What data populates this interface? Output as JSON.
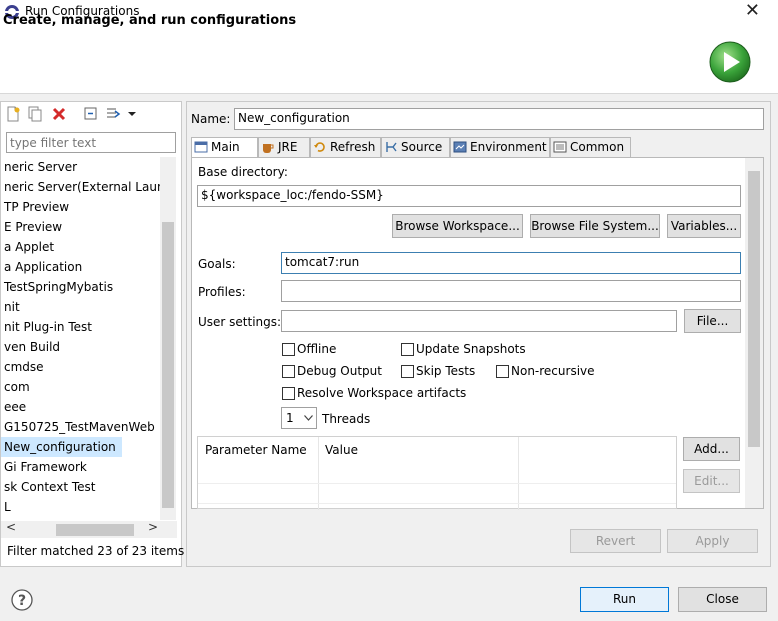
{
  "window": {
    "title": "Run Configurations",
    "close_glyph": "✕"
  },
  "banner": {
    "title": "Create, manage, and run configurations",
    "icon": "run-icon"
  },
  "left": {
    "toolbar_icons": [
      "new-launch-config-icon",
      "duplicate-icon",
      "delete-icon",
      "collapse-all-icon",
      "filter-icon",
      "chevron-down-icon"
    ],
    "filter_placeholder": "type filter text",
    "tree_items": [
      "neric Server",
      "neric Server(External Launc",
      "TP Preview",
      "E Preview",
      "a Applet",
      "a Application",
      "TestSpringMybatis",
      "nit",
      "nit Plug-in Test",
      "ven Build",
      "cmdse",
      "com",
      "eee",
      "G150725_TestMavenWeb",
      "New_configuration",
      "Gi Framework",
      "sk Context Test",
      "L"
    ],
    "selected_item": "New_configuration",
    "hscroll_left": "<",
    "hscroll_right": ">",
    "filter_status": "Filter matched 23 of 23 items"
  },
  "right": {
    "name_label": "Name:",
    "name_value": "New_configuration",
    "tabs": [
      {
        "label": "Main",
        "icon": "main-tab-icon"
      },
      {
        "label": "JRE",
        "icon": "jre-icon"
      },
      {
        "label": "Refresh",
        "icon": "refresh-icon"
      },
      {
        "label": "Source",
        "icon": "source-icon"
      },
      {
        "label": "Environment",
        "icon": "environment-icon"
      },
      {
        "label": "Common",
        "icon": "common-icon"
      }
    ],
    "base_dir_label": "Base directory:",
    "base_dir_value": "${workspace_loc:/fendo-SSM}",
    "browse_workspace": "Browse Workspace...",
    "browse_fs": "Browse File System...",
    "variables": "Variables...",
    "goals_label": "Goals:",
    "goals_value": "tomcat7:run",
    "profiles_label": "Profiles:",
    "profiles_value": "",
    "user_settings_label": "User settings:",
    "user_settings_value": "",
    "file_button": "File...",
    "offline": "Offline",
    "update_snapshots": "Update Snapshots",
    "debug_output": "Debug Output",
    "skip_tests": "Skip Tests",
    "non_recursive": "Non-recursive",
    "resolve_ws": "Resolve Workspace artifacts",
    "threads_value": "1",
    "threads_label": "Threads",
    "param_col": "Parameter Name",
    "value_col": "Value",
    "add_button": "Add...",
    "edit_button": "Edit...",
    "revert_button": "Revert",
    "apply_button": "Apply"
  },
  "bottom": {
    "help_icon": "help-icon",
    "run_button": "Run",
    "close_button": "Close"
  },
  "colors": {
    "selection": "#cde8ff",
    "run_green": "#2f9e2f",
    "delete_red": "#d42b2b"
  }
}
